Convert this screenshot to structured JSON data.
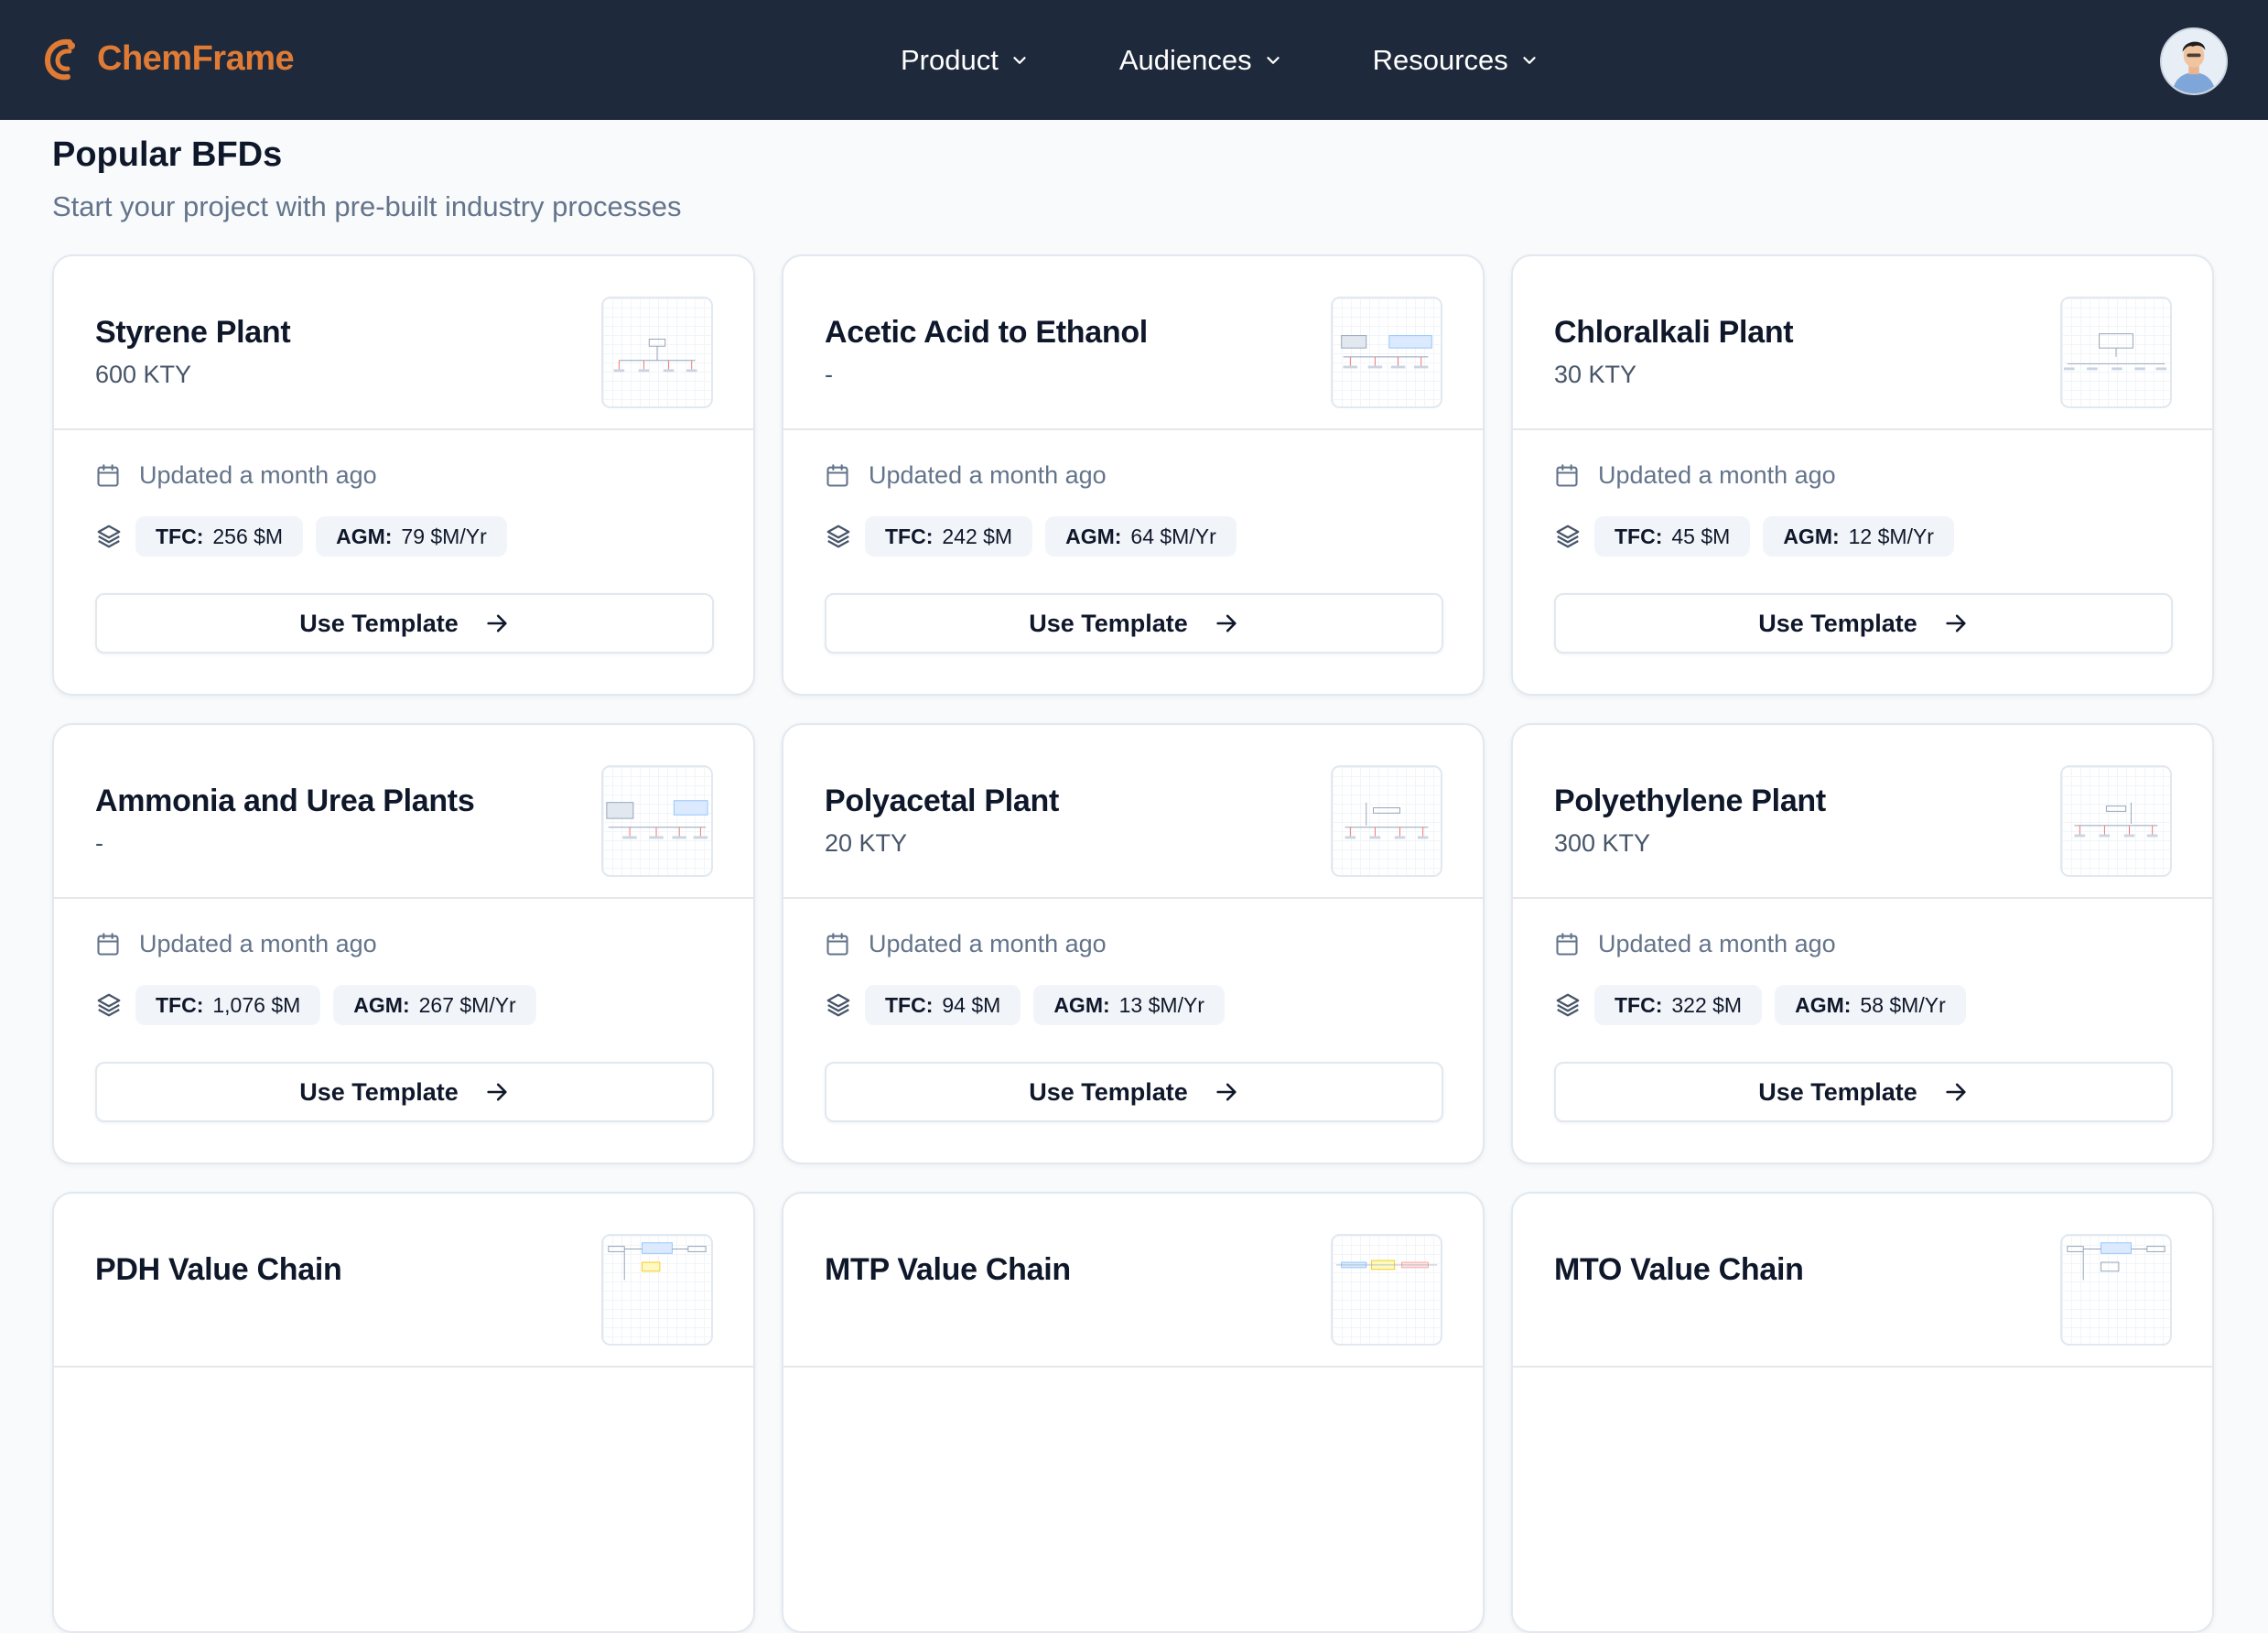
{
  "brand": {
    "name": "ChemFrame",
    "color": "#e07b35"
  },
  "nav": {
    "items": [
      {
        "label": "Product",
        "icon": "chevron-down-icon"
      },
      {
        "label": "Audiences",
        "icon": "chevron-down-icon"
      },
      {
        "label": "Resources",
        "icon": "chevron-down-icon"
      }
    ]
  },
  "section": {
    "title": "Popular BFDs",
    "subtitle": "Start your project with pre-built industry processes"
  },
  "card_labels": {
    "use_template": "Use Template",
    "tfc": "TFC:",
    "agm": "AGM:"
  },
  "cards": [
    {
      "title": "Styrene Plant",
      "capacity": "600 KTY",
      "updated": "Updated a month ago",
      "tfc": "256 $M",
      "agm": "79 $M/Yr"
    },
    {
      "title": "Acetic Acid to Ethanol",
      "capacity": "-",
      "updated": "Updated a month ago",
      "tfc": "242 $M",
      "agm": "64 $M/Yr"
    },
    {
      "title": "Chloralkali Plant",
      "capacity": "30 KTY",
      "updated": "Updated a month ago",
      "tfc": "45 $M",
      "agm": "12 $M/Yr"
    },
    {
      "title": "Ammonia and Urea Plants",
      "capacity": "-",
      "updated": "Updated a month ago",
      "tfc": "1,076 $M",
      "agm": "267 $M/Yr"
    },
    {
      "title": "Polyacetal Plant",
      "capacity": "20 KTY",
      "updated": "Updated a month ago",
      "tfc": "94 $M",
      "agm": "13 $M/Yr"
    },
    {
      "title": "Polyethylene Plant",
      "capacity": "300 KTY",
      "updated": "Updated a month ago",
      "tfc": "322 $M",
      "agm": "58 $M/Yr"
    },
    {
      "title": "PDH Value Chain"
    },
    {
      "title": "MTP Value Chain"
    },
    {
      "title": "MTO Value Chain"
    }
  ]
}
